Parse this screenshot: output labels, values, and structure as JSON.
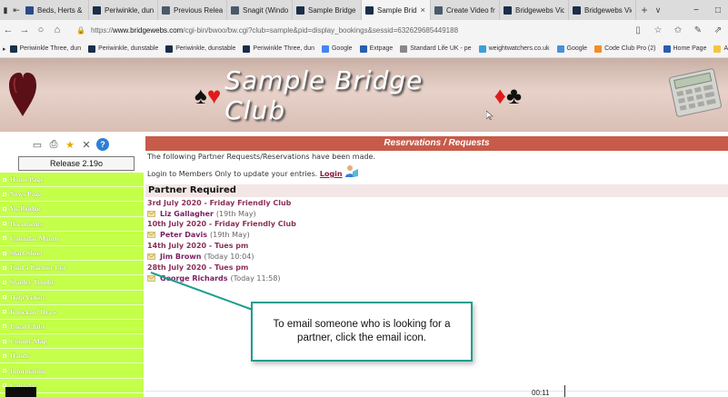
{
  "browser": {
    "tabs": [
      {
        "label": "Beds, Herts & Bu",
        "color": "#2b4b8a",
        "active": false
      },
      {
        "label": "Periwinkle, dunst",
        "color": "#1b2e4a",
        "active": false
      },
      {
        "label": "Previous Releas",
        "color": "#4a5a6a",
        "active": false
      },
      {
        "label": "Snagit (Window",
        "color": "#4a5a6a",
        "active": false
      },
      {
        "label": "Sample Bridge C",
        "color": "#1b2e4a",
        "active": false
      },
      {
        "label": "Sample Brid",
        "color": "#1b2e4a",
        "active": true
      },
      {
        "label": "Create Video fro",
        "color": "#4a5a6a",
        "active": false
      },
      {
        "label": "Bridgewebs Vide",
        "color": "#1b2e4a",
        "active": false
      },
      {
        "label": "Bridgewebs Vide",
        "color": "#1b2e4a",
        "active": false
      }
    ],
    "tab_close_glyph": "×",
    "new_tab_glyph": "+",
    "tab_list_glyph": "∨",
    "url_prefix": "https://",
    "url_host": "www.bridgewebs.com",
    "url_path": "/cgi-bin/bwoo/bw.cgi?club=sample&pid=display_bookings&sessid=632629685449188",
    "minimize_glyph": "−",
    "window_glyph": "□",
    "back_glyph": "←",
    "forward_glyph": "→",
    "refresh_glyph": "○",
    "home_glyph": "⌂"
  },
  "favorites": [
    {
      "label": "Periwinkle Three, dun",
      "color": "#1b2e4a"
    },
    {
      "label": "Periwinkle, dunstable",
      "color": "#1b2e4a"
    },
    {
      "label": "Periwinkle, dunstable",
      "color": "#1b2e4a"
    },
    {
      "label": "Periwinkle Three, dun",
      "color": "#1b2e4a"
    },
    {
      "label": "Google",
      "color": "#4285f4"
    },
    {
      "label": "Extpage",
      "color": "#2a5db0"
    },
    {
      "label": "Standard Life UK - pe",
      "color": "#888888"
    },
    {
      "label": "weightwatchers.co.uk",
      "color": "#3aa0d8"
    },
    {
      "label": "Google",
      "color": "#4a90d9"
    },
    {
      "label": "Code Club Pro (2)",
      "color": "#f28c28"
    },
    {
      "label": "Home Page",
      "color": "#2a5db0"
    },
    {
      "label": "ASUS E-Service",
      "color": "#f4c542"
    }
  ],
  "banner": {
    "title": "Sample Bridge Club",
    "suit_spade": "♠",
    "suit_heart": "♥",
    "suit_diamond": "♦",
    "suit_club": "♣"
  },
  "sidebar": {
    "release": "Release 2.19o",
    "menu": [
      "Home Page",
      "News Page",
      "Vu-Bridge",
      "Documents",
      "Calendar Month",
      "Start Sheet",
      "Find a Partner List",
      "Stanley Trophy",
      "Help Videos",
      "Knockout Draw",
      "Local Clubs",
      "County Map",
      "Hands",
      "Information",
      "Calendar"
    ]
  },
  "main": {
    "header": "Reservations / Requests",
    "intro": "The following Partner Requests/Reservations have been made.",
    "login_text": "Login to Members Only to update your entries.",
    "login_link": "Login",
    "section_title": "Partner Required",
    "requests": [
      {
        "date": "3rd July 2020 - Friday Friendly Club",
        "name": "Liz Gallagher",
        "when": "(19th May)"
      },
      {
        "date": "10th July 2020 - Friday Friendly Club",
        "name": "Peter Davis",
        "when": "(19th May)"
      },
      {
        "date": "14th July 2020 - Tues pm",
        "name": "Jim Brown",
        "when": "(Today 10:04)"
      },
      {
        "date": "28th July 2020 - Tues pm",
        "name": "George Richards",
        "when": "(Today 11:58)"
      }
    ]
  },
  "callout": {
    "text": "To email someone who is looking for a partner, click the email icon."
  },
  "video": {
    "timecode": "00:11"
  }
}
